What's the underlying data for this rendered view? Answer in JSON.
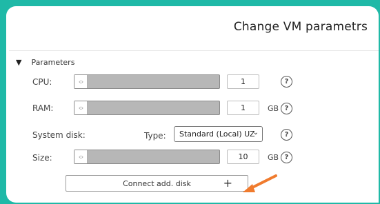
{
  "header": {
    "title": "Change VM parametrs"
  },
  "section": {
    "label": "Parameters"
  },
  "cpu": {
    "label": "CPU:",
    "value": "1",
    "help": "?"
  },
  "ram": {
    "label": "RAM:",
    "value": "1",
    "unit": "GB",
    "help": "?"
  },
  "system_disk": {
    "label": "System disk:",
    "type_label": "Type:",
    "type_value": "Standard (Local) UZ",
    "help": "?"
  },
  "size": {
    "label": "Size:",
    "value": "10",
    "unit": "GB",
    "help": "?"
  },
  "connect_button": {
    "label": "Connect add. disk",
    "icon": "plus-icon"
  },
  "colors": {
    "accent": "#1fb9a7",
    "arrow": "#f07b2e",
    "slider": "#b7b7b7"
  }
}
